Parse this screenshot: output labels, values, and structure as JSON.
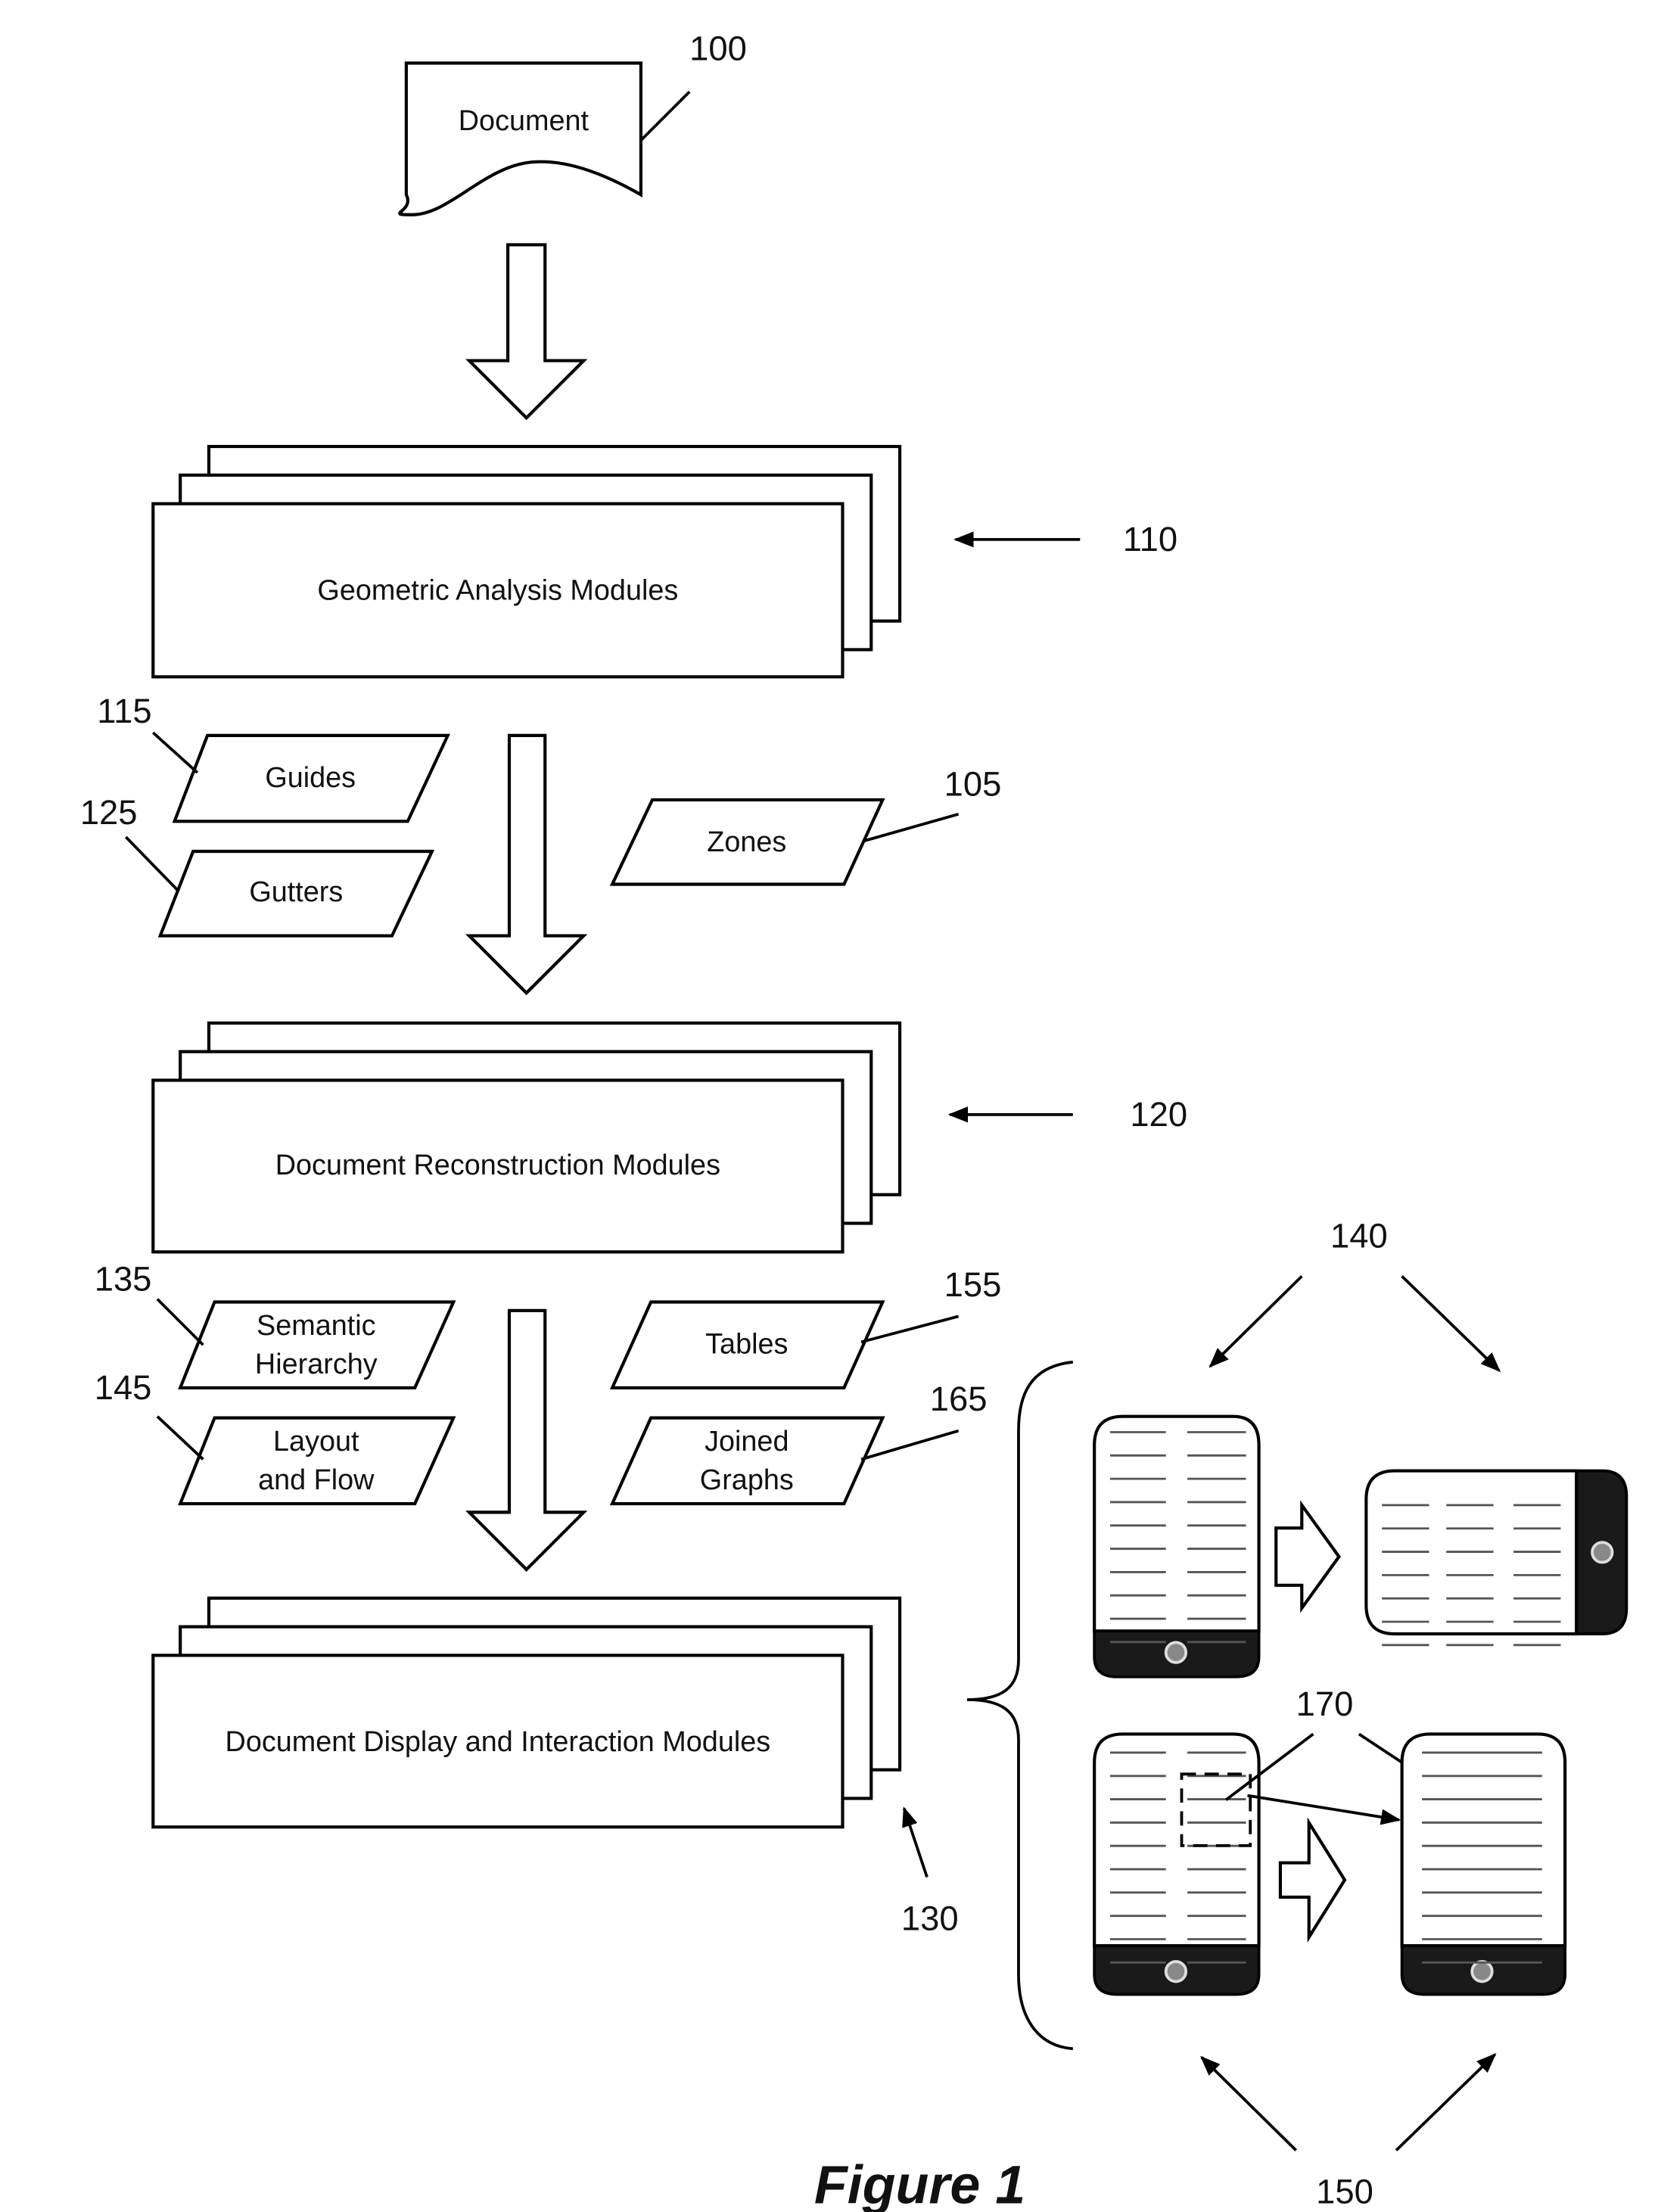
{
  "figure": {
    "caption": "Figure 1",
    "nodes": {
      "document": {
        "label": "Document",
        "ref": "100"
      },
      "geometric": {
        "label": "Geometric Analysis Modules",
        "ref": "110"
      },
      "reconstruction": {
        "label": "Document Reconstruction Modules",
        "ref": "120"
      },
      "display": {
        "label": "Document Display and Interaction Modules",
        "ref": "130"
      }
    },
    "data_items": {
      "guides": {
        "label": "Guides",
        "ref": "115"
      },
      "gutters": {
        "label": "Gutters",
        "ref": "125"
      },
      "zones": {
        "label": "Zones",
        "ref": "105"
      },
      "semantic": {
        "label_line1": "Semantic",
        "label_line2": "Hierarchy",
        "ref": "135"
      },
      "layout": {
        "label_line1": "Layout",
        "label_line2": "and Flow",
        "ref": "145"
      },
      "tables": {
        "label": "Tables",
        "ref": "155"
      },
      "joined": {
        "label_line1": "Joined",
        "label_line2": "Graphs",
        "ref": "165"
      }
    },
    "devices": {
      "rotation_ref": "140",
      "zoom_ref": "150",
      "selection_ref": "170"
    }
  }
}
